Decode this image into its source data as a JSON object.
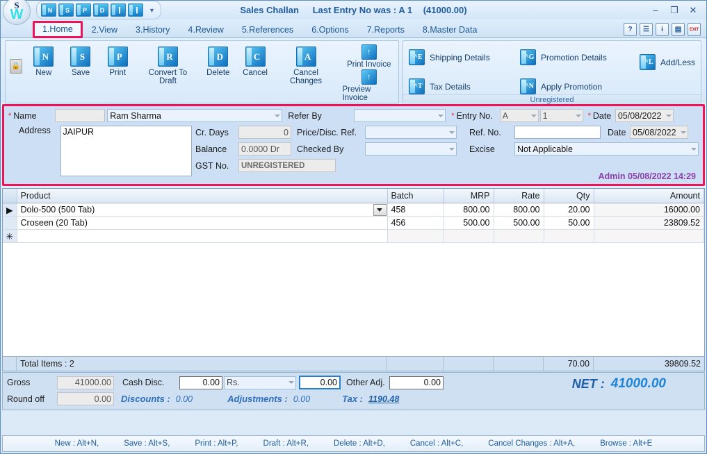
{
  "window": {
    "title": "Sales Challan",
    "last_entry": "Last Entry No was : A 1",
    "last_entry_amount": "(41000.00)",
    "minimize": "–",
    "maximize": "❐",
    "close": "✕"
  },
  "quick_access": {
    "buttons": [
      {
        "name": "new",
        "glyph": "N"
      },
      {
        "name": "save",
        "glyph": "S"
      },
      {
        "name": "print",
        "glyph": "P"
      },
      {
        "name": "delete",
        "glyph": "D"
      },
      {
        "name": "prev",
        "glyph": "❙"
      },
      {
        "name": "next",
        "glyph": "❙"
      }
    ],
    "customize": "▼"
  },
  "tabs": [
    {
      "label": "1.Home",
      "active": true
    },
    {
      "label": "2.View",
      "active": false
    },
    {
      "label": "3.History",
      "active": false
    },
    {
      "label": "4.Review",
      "active": false
    },
    {
      "label": "5.References",
      "active": false
    },
    {
      "label": "6.Options",
      "active": false
    },
    {
      "label": "7.Reports",
      "active": false
    },
    {
      "label": "8.Master Data",
      "active": false
    }
  ],
  "titlebar_icons": [
    {
      "name": "help-icon",
      "glyph": "?"
    },
    {
      "name": "notes-icon",
      "glyph": "☰"
    },
    {
      "name": "info-icon",
      "glyph": "i"
    },
    {
      "name": "document-check-icon",
      "glyph": "▤"
    },
    {
      "name": "exit-icon",
      "glyph": "EXIT"
    }
  ],
  "ribbon": {
    "group1": {
      "lock_icon": "🔒",
      "buttons": [
        {
          "label": "New",
          "glyph": "N"
        },
        {
          "label": "Save",
          "glyph": "S"
        },
        {
          "label": "Print",
          "glyph": "P"
        },
        {
          "label": "Convert To Draft",
          "glyph": "R"
        },
        {
          "label": "Delete",
          "glyph": "D"
        },
        {
          "label": "Cancel",
          "glyph": "C"
        },
        {
          "label": "Cancel Changes",
          "glyph": "A"
        }
      ],
      "invoice": [
        {
          "label": "Print Invoice",
          "glyph": "↑"
        },
        {
          "label": "Preview Invoice",
          "glyph": "↑"
        }
      ]
    },
    "group2": {
      "caption": "Unregistered",
      "items": [
        {
          "label": "Shipping Details",
          "glyph": "^E"
        },
        {
          "label": "Promotion Details",
          "glyph": "^G"
        },
        {
          "label": "Add/Less",
          "glyph": "^L"
        },
        {
          "label": "Tax Details",
          "glyph": "^T"
        },
        {
          "label": "Apply Promotion",
          "glyph": "^N"
        }
      ]
    }
  },
  "form": {
    "name_label": "Name",
    "name_code": "",
    "name_value": "Ram Sharma",
    "address_label": "Address",
    "address_value": "JAIPUR",
    "cr_days_label": "Cr. Days",
    "cr_days_value": "0",
    "balance_label": "Balance",
    "balance_value": "0.0000 Dr",
    "gst_label": "GST No.",
    "gst_value": "UNREGISTERED",
    "refer_by_label": "Refer By",
    "refer_by_value": "",
    "price_disc_label": "Price/Disc. Ref.",
    "price_disc_value": "",
    "checked_by_label": "Checked By",
    "checked_by_value": "",
    "entry_no_label": "Entry No.",
    "entry_series": "A",
    "entry_number": "1",
    "date_label": "Date",
    "date_value": "05/08/2022",
    "ref_no_label": "Ref. No.",
    "ref_no_value": "",
    "date2_label": "Date",
    "date2_value": "05/08/2022",
    "excise_label": "Excise",
    "excise_value": "Not Applicable",
    "stamp": "Admin 05/08/2022 14:29"
  },
  "grid": {
    "columns": [
      "Product",
      "Batch",
      "MRP",
      "Rate",
      "Qty",
      "Amount"
    ],
    "rows": [
      {
        "marker": "▶",
        "product": "Dolo-500 (500 Tab)",
        "batch": "458",
        "mrp": "800.00",
        "rate": "800.00",
        "qty": "20.00",
        "amount": "16000.00",
        "dropdown": true
      },
      {
        "marker": "",
        "product": "Croseen (20 Tab)",
        "batch": "456",
        "mrp": "500.00",
        "rate": "500.00",
        "qty": "50.00",
        "amount": "23809.52",
        "dropdown": false
      },
      {
        "marker": "✳",
        "product": "",
        "batch": "",
        "mrp": "",
        "rate": "",
        "qty": "",
        "amount": "",
        "dropdown": false
      }
    ],
    "total_items_label": "Total Items : 2",
    "total_qty": "70.00",
    "total_amount": "39809.52"
  },
  "footer": {
    "gross_label": "Gross",
    "gross_value": "41000.00",
    "round_off_label": "Round off",
    "round_off_value": "0.00",
    "cash_disc_label": "Cash Disc.",
    "cash_disc_value": "0.00",
    "currency_value": "Rs.",
    "cash_disc_amount": "0.00",
    "other_adj_label": "Other Adj.",
    "other_adj_value": "0.00",
    "discounts_label": "Discounts :",
    "discounts_value": "0.00",
    "adjustments_label": "Adjustments :",
    "adjustments_value": "0.00",
    "tax_label": "Tax :",
    "tax_value": "1190.48",
    "net_label": "NET :",
    "net_value": "41000.00"
  },
  "status": [
    "New : Alt+N,",
    "Save : Alt+S,",
    "Print : Alt+P,",
    "Draft : Alt+R,",
    "Delete : Alt+D,",
    "Cancel : Alt+C,",
    "Cancel Changes : Alt+A,",
    "Browse : Alt+E"
  ]
}
